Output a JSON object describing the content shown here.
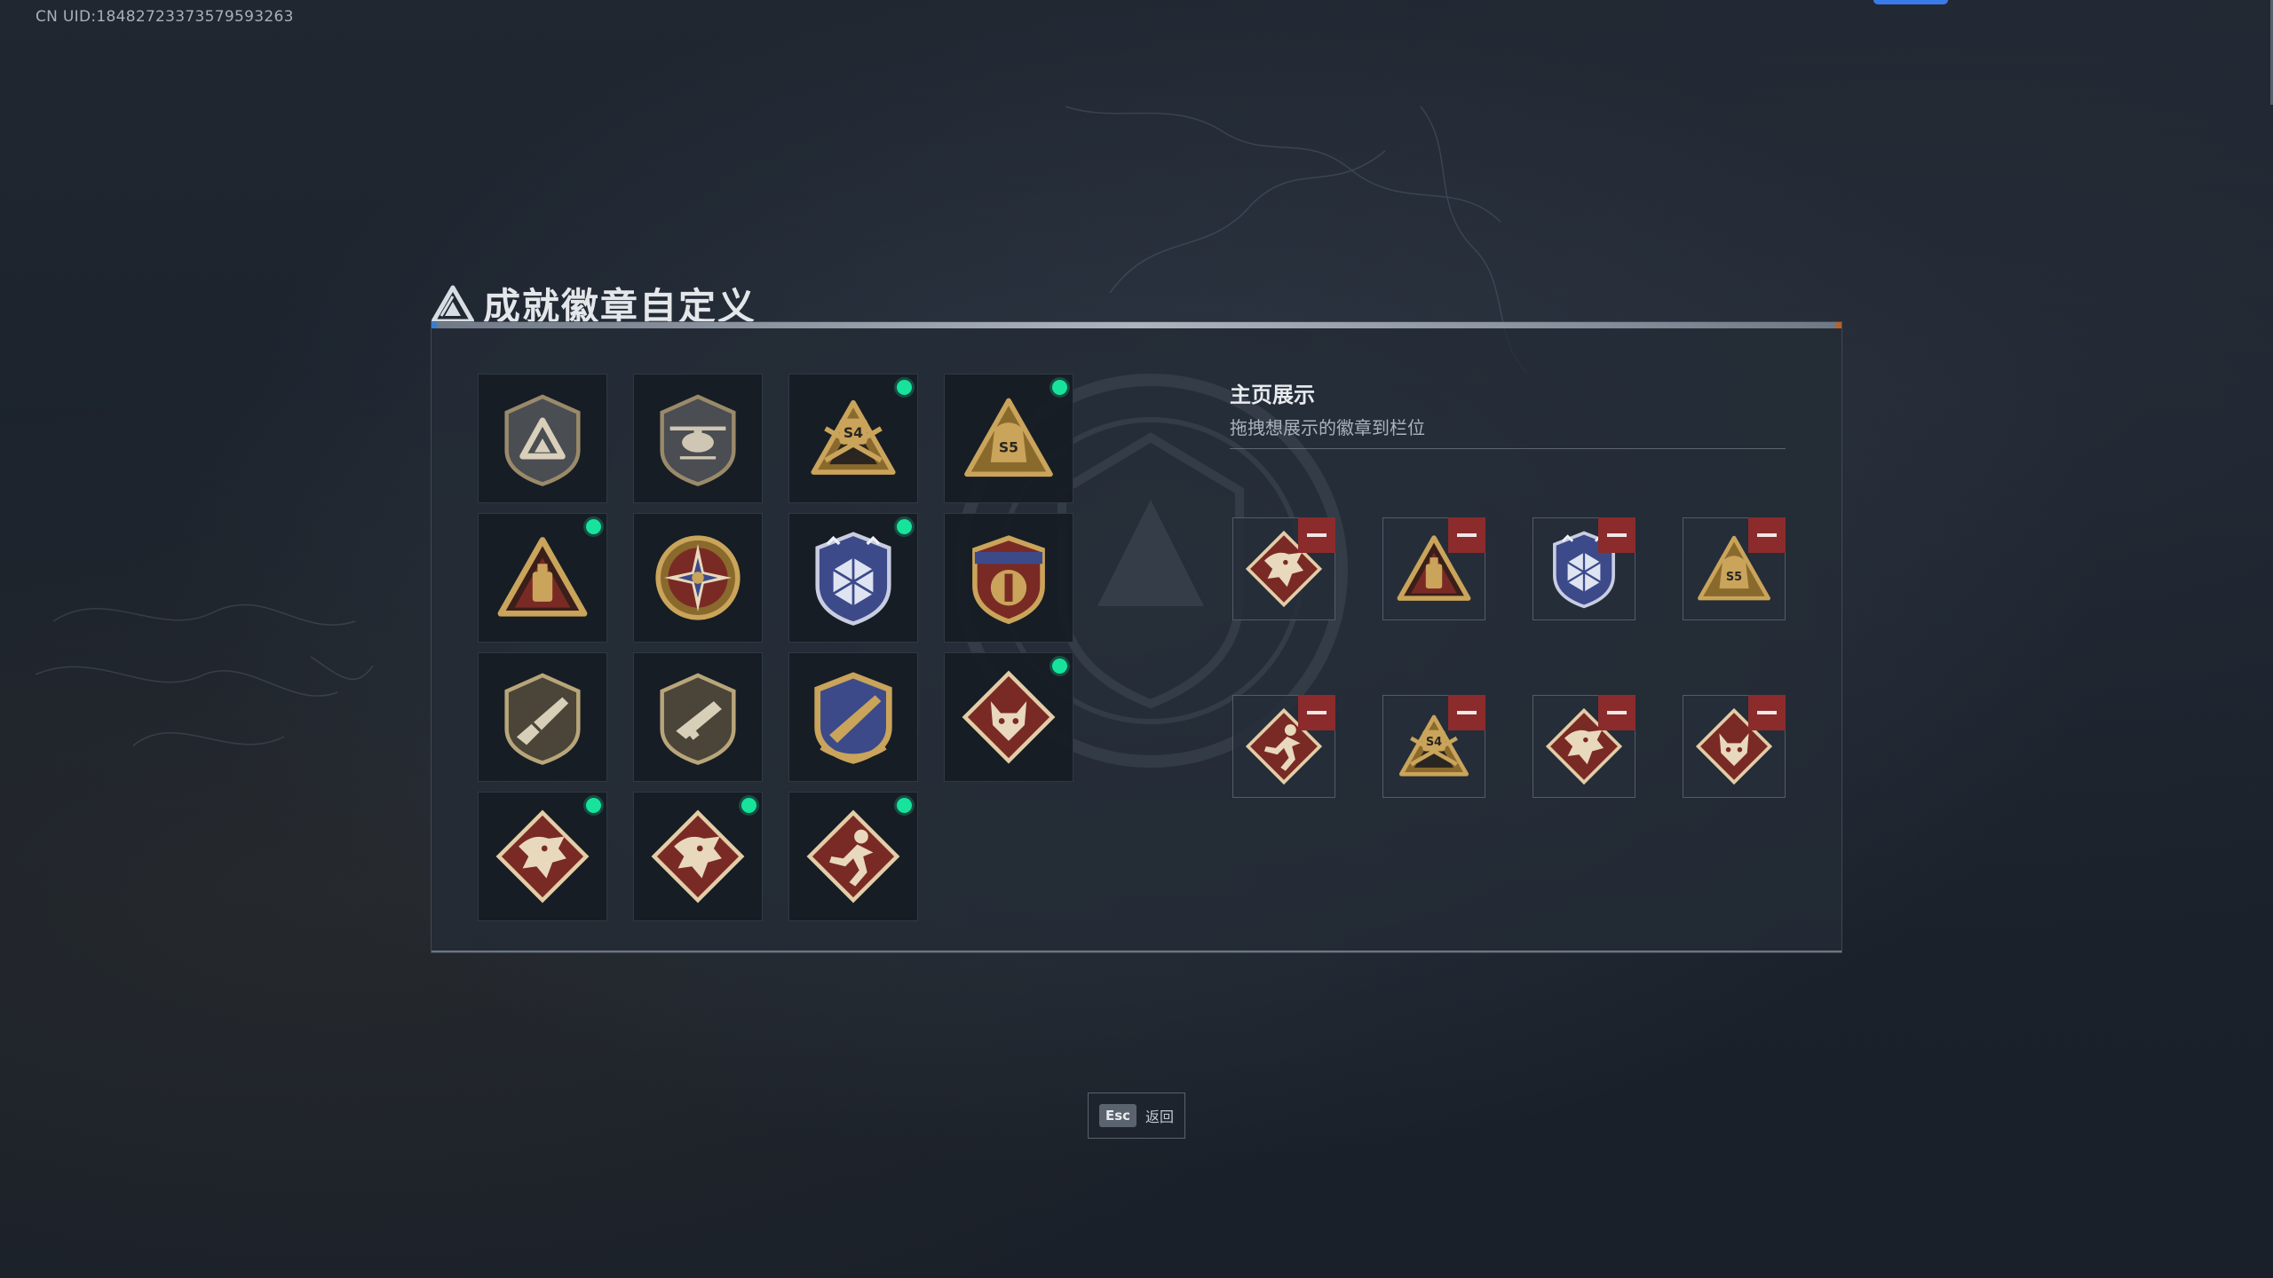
{
  "header": {
    "uid_text": "CN UID:18482723373579593263",
    "title": "成就徽章自定义"
  },
  "badge_grid": {
    "items": [
      {
        "icon": "triangle-shield-badge",
        "new": false
      },
      {
        "icon": "helicopter-shield-badge",
        "new": false
      },
      {
        "icon": "s4-gold-triangle-badge",
        "new": true
      },
      {
        "icon": "s5-gold-bag-badge",
        "new": true
      },
      {
        "icon": "gold-triangle-badge",
        "new": true
      },
      {
        "icon": "star-wheel-badge",
        "new": false
      },
      {
        "icon": "blue-diamond-shield-badge",
        "new": true
      },
      {
        "icon": "red-gold-crest-badge",
        "new": false
      },
      {
        "icon": "rifle-shield-badge",
        "new": false
      },
      {
        "icon": "smg-shield-badge",
        "new": false
      },
      {
        "icon": "blue-gold-rifle-crest-badge",
        "new": false
      },
      {
        "icon": "wolf-diamond-badge",
        "new": true
      },
      {
        "icon": "dragon-diamond-badge",
        "new": true
      },
      {
        "icon": "dragon-diamond-badge",
        "new": true
      },
      {
        "icon": "runner-diamond-badge",
        "new": true
      }
    ]
  },
  "showcase": {
    "title": "主页展示",
    "subtitle": "拖拽想展示的徽章到栏位",
    "slots": [
      {
        "icon": "dragon-diamond-badge"
      },
      {
        "icon": "gold-triangle-badge"
      },
      {
        "icon": "blue-diamond-shield-badge"
      },
      {
        "icon": "s5-gold-bag-badge"
      },
      {
        "icon": "runner-diamond-badge"
      },
      {
        "icon": "s4-gold-triangle-badge"
      },
      {
        "icon": "dragon-diamond-badge"
      },
      {
        "icon": "wolf-diamond-badge"
      }
    ]
  },
  "footer": {
    "esc_key": "Esc",
    "esc_label": "返回"
  },
  "colors": {
    "new_indicator": "#17e39c",
    "remove_button": "#8c2b2b",
    "accent_blue": "#3b7be9",
    "gold": "#c9a45a"
  }
}
